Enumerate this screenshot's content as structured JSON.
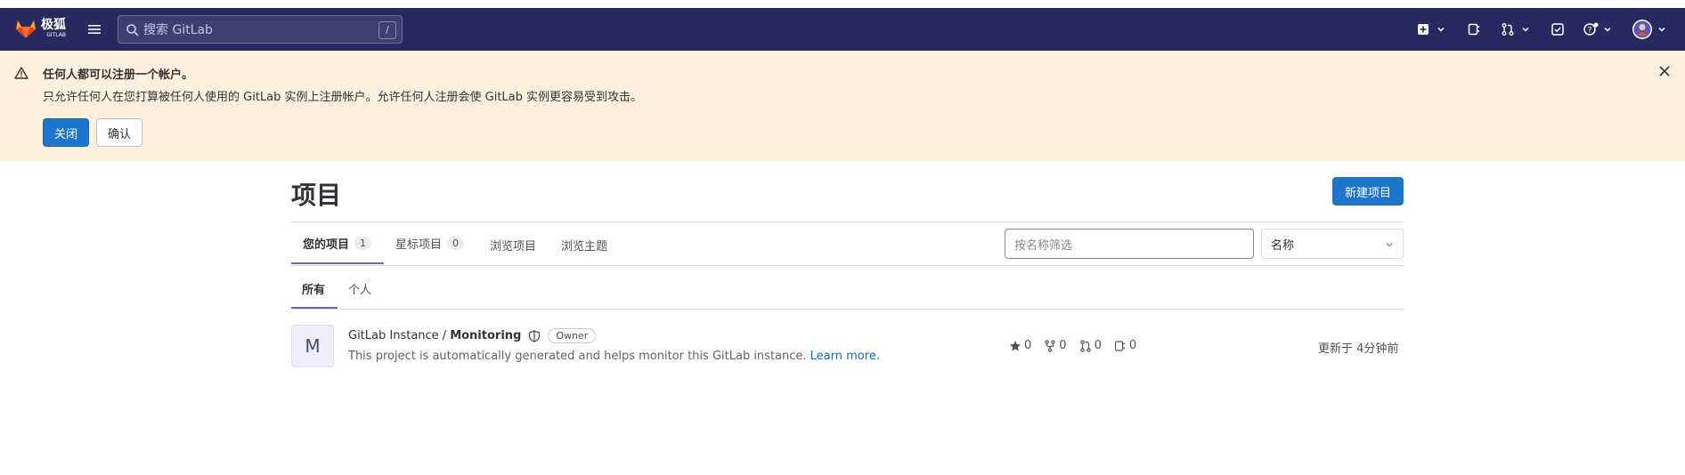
{
  "topbar": {
    "logo_text": "极狐",
    "logo_sub": "GITLAB",
    "search_placeholder": "搜索 GitLab",
    "search_shortcut": "/"
  },
  "alert": {
    "title": "任何人都可以注册一个帐户。",
    "body": "只允许任何人在您打算被任何人使用的 GitLab 实例上注册帐户。允许任何人注册会使 GitLab 实例更容易受到攻击。",
    "primary_button": "关闭",
    "secondary_button": "确认"
  },
  "page": {
    "title": "项目",
    "new_project_button": "新建项目"
  },
  "tabs": [
    {
      "label": "您的项目",
      "count": "1"
    },
    {
      "label": "星标项目",
      "count": "0"
    },
    {
      "label": "浏览项目"
    },
    {
      "label": "浏览主题"
    }
  ],
  "filter": {
    "placeholder": "按名称筛选",
    "sort_value": "名称"
  },
  "subtabs": [
    {
      "label": "所有"
    },
    {
      "label": "个人"
    }
  ],
  "project": {
    "avatar_letter": "M",
    "namespace": "GitLab Instance /",
    "name": "Monitoring",
    "badge": "Owner",
    "description": "This project is automatically generated and helps monitor this GitLab instance.",
    "learn_more": "Learn more.",
    "stars": "0",
    "forks": "0",
    "merge_requests": "0",
    "issues": "0",
    "updated": "更新于 4分钟前"
  },
  "colors": {
    "topbar": "#292961",
    "alert_bg": "#fdf1dd",
    "primary": "#1f75cb",
    "tab_underline": "#6666c4"
  }
}
